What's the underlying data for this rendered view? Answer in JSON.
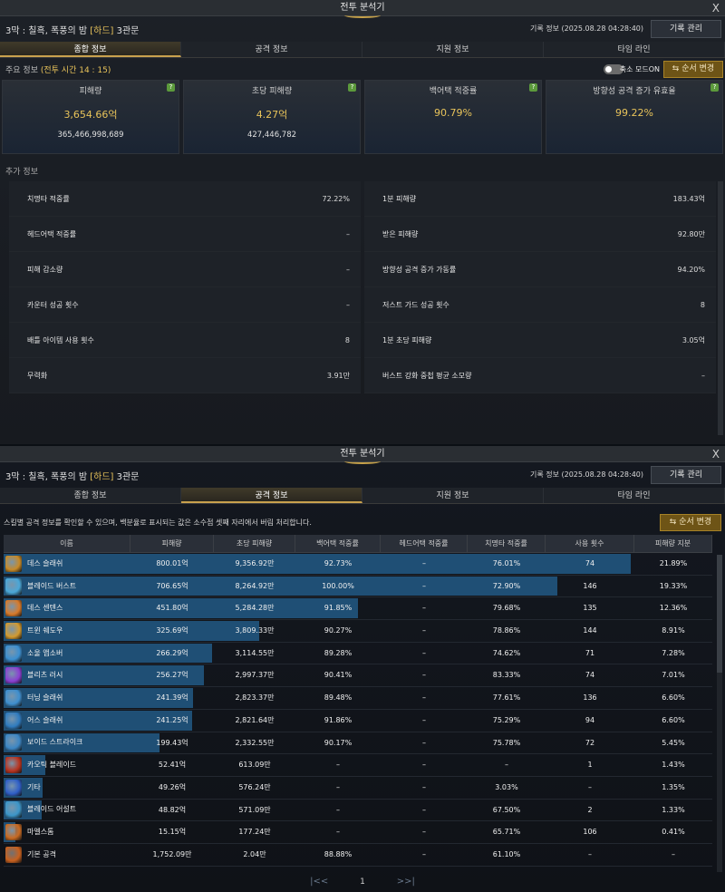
{
  "window1": {
    "title": "전투 분석기",
    "close": "X",
    "header": {
      "stage": "3막 : 칠흑, 폭풍의 밤",
      "difficulty": "[하드]",
      "gate": "3관문",
      "record_info": "기록 정보 (2025.08.28 04:28:40)",
      "record_btn": "기록 관리"
    },
    "tabs": [
      "종합 정보",
      "공격 정보",
      "지원 정보",
      "타임 라인"
    ],
    "main_info": {
      "label": "주요 정보",
      "combat_time_label": "(전투 시간 14 : 15)"
    },
    "reduce_mode": "축소 모드ON",
    "order_btn": "순서 변경",
    "cards": [
      {
        "title": "피해량",
        "value": "3,654.66억",
        "sub": "365,466,998,689"
      },
      {
        "title": "초당 피해량",
        "value": "4.27억",
        "sub": "427,446,782"
      },
      {
        "title": "백어택 적중률",
        "value": "90.79%",
        "sub": ""
      },
      {
        "title": "방향성 공격 증가 유효율",
        "value": "99.22%",
        "sub": ""
      }
    ],
    "extra_label": "추가 정보",
    "extra": [
      {
        "k": "치명타 적중률",
        "v": "72.22%"
      },
      {
        "k": "1분 피해량",
        "v": "183.43억"
      },
      {
        "k": "헤드어택 적중률",
        "v": "–"
      },
      {
        "k": "받은 피해량",
        "v": "92.80만"
      },
      {
        "k": "피해 감소량",
        "v": "–"
      },
      {
        "k": "방향성 공격 증가 가동률",
        "v": "94.20%"
      },
      {
        "k": "카운터 성공 횟수",
        "v": "–"
      },
      {
        "k": "저스트 가드 성공 횟수",
        "v": "8"
      },
      {
        "k": "배틀 아이템 사용 횟수",
        "v": "8"
      },
      {
        "k": "1분 초당 피해량",
        "v": "3.05억"
      },
      {
        "k": "무력화",
        "v": "3.91만"
      },
      {
        "k": "버스트 강화 중첩 평균 소모량",
        "v": "–"
      }
    ]
  },
  "window2": {
    "title": "전투 분석기",
    "close": "X",
    "header": {
      "stage": "3막 : 칠흑, 폭풍의 밤",
      "difficulty": "[하드]",
      "gate": "3관문",
      "record_info": "기록 정보 (2025.08.28 04:28:40)",
      "record_btn": "기록 관리"
    },
    "tabs": [
      "종합 정보",
      "공격 정보",
      "지원 정보",
      "타임 라인"
    ],
    "note": "스킬별 공격 정보를 확인할 수 있으며, 백분율로 표시되는 값은 소수점 셋째 자리에서 버림 처리합니다.",
    "order_btn": "순서 변경",
    "columns": [
      "이름",
      "피해량",
      "초당 피해량",
      "백어택 적중률",
      "헤드어택 적중률",
      "치명타 적중률",
      "사용 횟수",
      "피해량 지분"
    ],
    "rows": [
      {
        "name": "데스 슬래쉬",
        "dmg": "800.01억",
        "dps": "9,356.92만",
        "back": "92.73%",
        "head": "–",
        "crit": "76.01%",
        "uses": "74",
        "share": "21.89%",
        "bar": 1.0,
        "icon": "#c78a28"
      },
      {
        "name": "블레이드 버스트",
        "dmg": "706.65억",
        "dps": "8,264.92만",
        "back": "100.00%",
        "head": "–",
        "crit": "72.90%",
        "uses": "146",
        "share": "19.33%",
        "bar": 0.883,
        "icon": "#4aa7d8"
      },
      {
        "name": "데스 센텐스",
        "dmg": "451.80억",
        "dps": "5,284.28만",
        "back": "91.85%",
        "head": "–",
        "crit": "79.68%",
        "uses": "135",
        "share": "12.36%",
        "bar": 0.565,
        "icon": "#d87a2a"
      },
      {
        "name": "트윈 쉐도우",
        "dmg": "325.69억",
        "dps": "3,809.33만",
        "back": "90.27%",
        "head": "–",
        "crit": "78.86%",
        "uses": "144",
        "share": "8.91%",
        "bar": 0.407,
        "icon": "#d29a30"
      },
      {
        "name": "소울 앱소버",
        "dmg": "266.29억",
        "dps": "3,114.55만",
        "back": "89.28%",
        "head": "–",
        "crit": "74.62%",
        "uses": "71",
        "share": "7.28%",
        "bar": 0.333,
        "icon": "#3b8fd0"
      },
      {
        "name": "블리츠 러시",
        "dmg": "256.27억",
        "dps": "2,997.37만",
        "back": "90.41%",
        "head": "–",
        "crit": "83.33%",
        "uses": "74",
        "share": "7.01%",
        "bar": 0.32,
        "icon": "#8a3fd1"
      },
      {
        "name": "터닝 슬래쉬",
        "dmg": "241.39억",
        "dps": "2,823.37만",
        "back": "89.48%",
        "head": "–",
        "crit": "77.61%",
        "uses": "136",
        "share": "6.60%",
        "bar": 0.302,
        "icon": "#3e8fcf"
      },
      {
        "name": "어스 슬래쉬",
        "dmg": "241.25억",
        "dps": "2,821.64만",
        "back": "91.86%",
        "head": "–",
        "crit": "75.29%",
        "uses": "94",
        "share": "6.60%",
        "bar": 0.301,
        "icon": "#2f7bbf"
      },
      {
        "name": "보이드 스트라이크",
        "dmg": "199.43억",
        "dps": "2,332.55만",
        "back": "90.17%",
        "head": "–",
        "crit": "75.78%",
        "uses": "72",
        "share": "5.45%",
        "bar": 0.249,
        "icon": "#3c86c4"
      },
      {
        "name": "카오틱 블레이드",
        "dmg": "52.41억",
        "dps": "613.09만",
        "back": "–",
        "head": "–",
        "crit": "–",
        "uses": "1",
        "share": "1.43%",
        "bar": 0.066,
        "icon": "#b8331f"
      },
      {
        "name": "기타",
        "dmg": "49.26억",
        "dps": "576.24만",
        "back": "–",
        "head": "–",
        "crit": "3.03%",
        "uses": "–",
        "share": "1.35%",
        "bar": 0.062,
        "icon": "#2f5fc8"
      },
      {
        "name": "블레이드 어설트",
        "dmg": "48.82억",
        "dps": "571.09만",
        "back": "–",
        "head": "–",
        "crit": "67.50%",
        "uses": "2",
        "share": "1.33%",
        "bar": 0.061,
        "icon": "#3c96c9"
      },
      {
        "name": "마엘스톰",
        "dmg": "15.15억",
        "dps": "177.24만",
        "back": "–",
        "head": "–",
        "crit": "65.71%",
        "uses": "106",
        "share": "0.41%",
        "bar": 0.019,
        "icon": "#c86a22"
      },
      {
        "name": "기본 공격",
        "dmg": "1,752.09만",
        "dps": "2.04만",
        "back": "88.88%",
        "head": "–",
        "crit": "61.10%",
        "uses": "–",
        "share": "–",
        "bar": 0.0,
        "icon": "#c8601e"
      }
    ],
    "pager": {
      "first": "|<<",
      "page": "1",
      "last": ">>|"
    }
  }
}
